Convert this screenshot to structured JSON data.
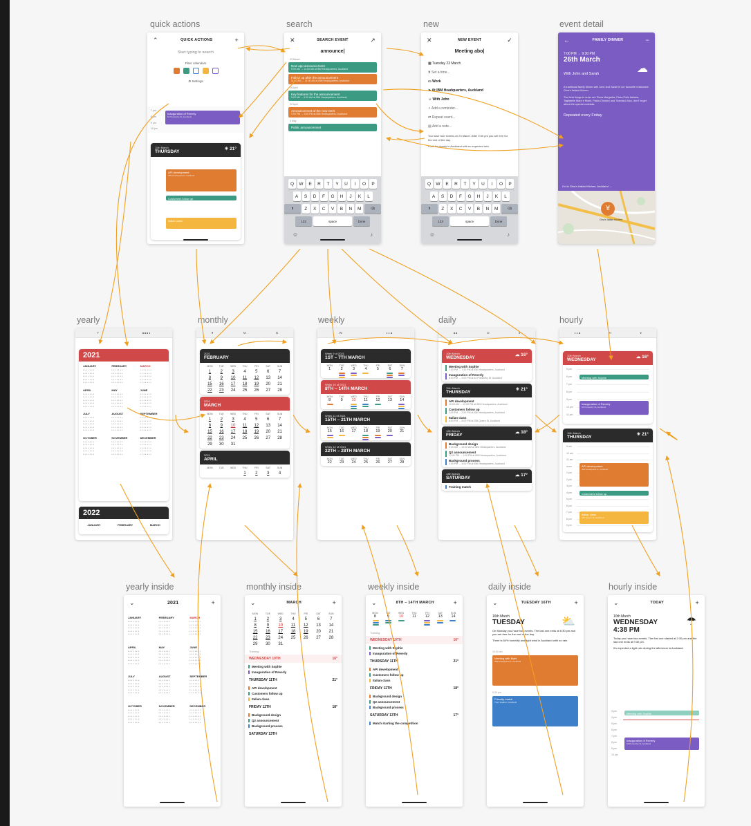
{
  "labels": {
    "quick_actions": "quick actions",
    "search": "search",
    "new": "new",
    "event_detail": "event detail",
    "yearly": "yearly",
    "monthly": "monthly",
    "weekly": "weekly",
    "daily": "daily",
    "hourly": "hourly",
    "yearly_inside": "yearly inside",
    "monthly_inside": "monthly inside",
    "weekly_inside": "weekly inside",
    "daily_inside": "daily inside",
    "hourly_inside": "hourly inside"
  },
  "colors": {
    "red": "#d04848",
    "dark": "#2b2b2b",
    "teal": "#3a9a82",
    "orange": "#e07b32",
    "purple": "#7a5cc2",
    "yellow": "#f4b63e",
    "blue": "#3d7fc9",
    "arrow": "#f0a020"
  },
  "quick": {
    "title": "QUICK ACTIONS",
    "search_hint": "Start typing to search",
    "filter": "Filter calendars",
    "settings": "Settings",
    "ev1": "Inauguration of Reverly",
    "ev1d": "64 Ponsonby St, Auckland",
    "date": "11th March",
    "day": "THURSDAY",
    "temp": "21°",
    "blk1": "API development",
    "blk1d": "IBM Headquarters, Auckland",
    "blk2": "Customers follow up",
    "blk3": "Italian class",
    "blk3d": "256 Queen St, Auckland",
    "times": [
      "7 pm",
      "8 pm",
      "9 pm",
      "10 pm"
    ],
    "times2": [
      "8 am",
      "9 am",
      "10 am",
      "11 am",
      "noon",
      "1 pm",
      "2 pm",
      "3 pm",
      "4 pm",
      "5 pm",
      "6 pm",
      "7 pm",
      "8 pm",
      "9 pm"
    ]
  },
  "search": {
    "title": "SEARCH EVENT",
    "query": "announce|",
    "d1": "23 March",
    "r1": "New app announcement",
    "r1d": "8:00 AM → 11:00 AM at IBM Headquarters, Auckland",
    "r2": "Follow up after the announcement",
    "r2d": "11:00 AM → 11:30 AM at IBM Headquarters, Auckland",
    "d2": "16 April",
    "r3": "Key features for the announcement",
    "r3d": "8:00 AM → 9:00 AM at IBM Headquarters, Auckland",
    "d3": "22 April",
    "r4": "Announcement of the new CEO",
    "r4d": "1:00 PM → 2:00 PM at IBM Headquarters, Auckland",
    "d4": "4 May",
    "r5": "Public announcement"
  },
  "kb": {
    "row1": [
      "Q",
      "W",
      "E",
      "R",
      "T",
      "Y",
      "U",
      "I",
      "O",
      "P"
    ],
    "row2": [
      "A",
      "S",
      "D",
      "F",
      "G",
      "H",
      "J",
      "K",
      "L"
    ],
    "row3": [
      "Z",
      "X",
      "C",
      "V",
      "B",
      "N",
      "M"
    ],
    "num": "123",
    "space": "space",
    "done": "Done"
  },
  "newev": {
    "title": "NEW EVENT",
    "query": "Meeting abo|",
    "date": "Tuesday 23 March",
    "time": "Set a time...",
    "cal": "Work",
    "place": "At IBM Headquarters, Auckland",
    "with": "With John",
    "rem": "Add a reminder...",
    "rep": "Repeat event...",
    "note": "Add a note...",
    "info": "You have four events on 23 March. After 9:30 pm you are free for the rest of the day.",
    "info2": "It will be cloudy in Auckland with no expected rain."
  },
  "detail": {
    "title": "FAMILY DINNER",
    "time": "7:00 PM → 9:30 PM",
    "date": "26th March",
    "with": "With John and Sarah",
    "desc": "A traditional family dinner with John and Sarah in our favourite restaurant: Gina's Italian Kitchen.",
    "desc2": "The best things to order are Pizza Margarita, Pizza Pollo Italiana, Tagliatelle Mare e Monti, Pasta Chicken and Tiramisu! Also, don't forget about the special cocktails.",
    "repeat": "Repeated every Friday",
    "goto": "Go to Gina's Italian Kitchen, Auckland →",
    "map_label": "Gina's Italian Kitchen"
  },
  "tabs": {
    "y": "Y",
    "m": "M",
    "w": "W",
    "d": "D",
    "h": "H"
  },
  "yearly": {
    "y1": "2021",
    "y2": "2022",
    "months": [
      "JANUARY",
      "FEBRUARY",
      "MARCH",
      "APRIL",
      "MAY",
      "JUNE",
      "JULY",
      "AUGUST",
      "SEPTEMBER",
      "OCTOBER",
      "NOVEMBER",
      "DECEMBER"
    ],
    "m2": [
      "JANUARY",
      "FEBRUARY",
      "MARCH"
    ]
  },
  "monthly": {
    "c1y": "2021",
    "c1m": "FEBRUARY",
    "c2y": "2021",
    "c2m": "MARCH",
    "c3y": "2021",
    "c3m": "APRIL",
    "days": [
      "MON",
      "TUE",
      "WED",
      "THU",
      "FRI",
      "SAT",
      "SUN"
    ],
    "feb": [
      "1",
      "2",
      "3",
      "4",
      "5",
      "6",
      "7",
      "8",
      "9",
      "10",
      "11",
      "12",
      "13",
      "14",
      "15",
      "16",
      "17",
      "18",
      "19",
      "20",
      "21",
      "22",
      "23",
      "24",
      "25",
      "26",
      "27",
      "28"
    ],
    "mar": [
      "1",
      "2",
      "3",
      "4",
      "5",
      "6",
      "7",
      "8",
      "9",
      "10",
      "11",
      "12",
      "13",
      "14",
      "15",
      "16",
      "17",
      "18",
      "19",
      "20",
      "21",
      "22",
      "23",
      "24",
      "25",
      "26",
      "27",
      "28",
      "29",
      "30",
      "31"
    ],
    "apr": [
      "1",
      "2",
      "3",
      "4"
    ]
  },
  "weekly": {
    "w1s": "Week 9 of 2021",
    "w1": "1ST – 7TH MARCH",
    "w2s": "Week 10 of 2021",
    "w2": "8TH – 14TH MARCH",
    "w3s": "Week 11 of 2021",
    "w3": "15TH – 21TH MARCH",
    "w4s": "Week 12 of 2021",
    "w4": "22TH – 28TH MARCH",
    "d1": [
      "1",
      "2",
      "3",
      "4",
      "5",
      "6",
      "7"
    ],
    "d2": [
      "8",
      "9",
      "10",
      "11",
      "12",
      "13",
      "14"
    ],
    "d3": [
      "15",
      "16",
      "17",
      "18",
      "19",
      "20",
      "21"
    ],
    "d4": [
      "22",
      "23",
      "24",
      "25",
      "26",
      "27",
      "28"
    ]
  },
  "daily": {
    "c1s": "10th March",
    "c1": "WEDNESDAY",
    "c1t": "16°",
    "e1": "Meeting with Sophie",
    "e1d": "7:00 PM → 7:30 PM at IBM Headquarters, Auckland",
    "e2": "Inauguration of Reverly",
    "e2d": "8:00 PM → 9:00 PM at 64 Ponsonby St, Auckland",
    "c2s": "11th March",
    "c2": "THURSDAY",
    "c2t": "21°",
    "e3": "API development",
    "e3d": "10:00 AM → 12:00 PM at IBM Headquarters, Auckland",
    "e4": "Customers follow up",
    "e4d": "2:00 PM → 2:30 PM at IBM Headquarters, Auckland",
    "e5": "Italian class",
    "e5d": "6:00 PM → 8:00 PM at 256 Queen St, Auckland",
    "c3s": "12th March",
    "c3": "FRIDAY",
    "c3t": "18°",
    "e6": "Background design",
    "e6d": "9:00 AM → 10:00 AM at IBM Headquarters, Auckland",
    "e7": "Q2 announcement",
    "e7d": "12:00 PM → 1:00 PM at IBM Headquarters, Auckland",
    "e8": "Background process",
    "e8d": "2:00 PM → 4:00 PM at IBM Headquarters, Auckland",
    "c4s": "13th March",
    "c4": "SATURDAY",
    "c4t": "17°",
    "e9": "Training match"
  },
  "hourly": {
    "c1s": "10th March",
    "c1": "WEDNESDAY",
    "c1t": "16°",
    "e1": "Meeting with Sophie",
    "e2": "Inauguration of Reverly",
    "e2d": "64 Ponsonby St, Auckland",
    "c2s": "11th March",
    "c2": "THURSDAY",
    "c2t": "21°",
    "e3": "API development",
    "e3d": "IBM Headquarters, Auckland",
    "e4": "Customers follow up",
    "e5": "Italian class",
    "e5d": "256 Queen St, Auckland",
    "times1": [
      "5 pm",
      "6 pm",
      "7 pm",
      "8 pm",
      "9 pm",
      "10 pm",
      "11 pm"
    ],
    "times2": [
      "9 am",
      "10 am",
      "11 am",
      "noon",
      "1 pm",
      "2 pm",
      "3 pm",
      "4 pm",
      "5 pm",
      "6 pm",
      "7 pm",
      "8 pm",
      "9 pm"
    ]
  },
  "yin": {
    "title": "2021"
  },
  "min": {
    "title": "MARCH",
    "s1": "WEDNESDAY 10TH",
    "s1t": "16°",
    "e1": "Meeting with Sophie",
    "e2": "Inauguration of Reverly",
    "s2": "THURSDAY 11TH",
    "s2t": "21°",
    "e3": "API development",
    "e4": "Customers follow up",
    "e5": "Italian class",
    "s3": "FRIDAY 12TH",
    "s3t": "18°",
    "e6": "Background design",
    "e7": "Q2 announcement",
    "e8": "Background process",
    "s4": "SATURDAY 13TH",
    "tr": "Training"
  },
  "win": {
    "title": "8TH – 14TH MARCH",
    "tr": "Training",
    "s1": "WEDNESDAY 10TH",
    "s1t": "16°",
    "e1": "Meeting with Sophie",
    "e2": "Inauguration of Reverly",
    "s2": "THURSDAY 11TH",
    "s2t": "21°",
    "e3": "API development",
    "e4": "Customers follow up",
    "e5": "Italian class",
    "s3": "FRIDAY 12TH",
    "s3t": "18°",
    "e6": "Background design",
    "e7": "Q2 announcement",
    "e8": "Background process",
    "s4": "SATURDAY 13TH",
    "s4t": "17°",
    "e9": "Match starting the competition"
  },
  "din": {
    "title": "TUESDAY 16TH",
    "s": "16th March",
    "day": "TUESDAY",
    "info": "On Monday you have two events. The last one ends at 6:30 pm and you are free for the rest of the day.",
    "info2": "There is 84% humidity and light wind in Auckland with no rain.",
    "t1": "10:00 am",
    "b1": "Meeting with Mark",
    "b1d": "IBM Headquarters, Auckland",
    "t2": "5:30 pm",
    "b2": "Friendly match",
    "b2d": "Tyler Stadium, Auckland"
  },
  "hin": {
    "title": "TODAY",
    "s": "10th March",
    "day": "WEDNESDAY",
    "time": "4:38 PM",
    "info": "Today you have two events. The first one started at 2:30 pm and the last one ends at 9:30 pm.",
    "info2": "It's expected a light rain during the afternoon in Auckland.",
    "e1": "Meeting with Sophie",
    "e2": "Inauguration of Reverly",
    "e2d": "64 Ponsonby St, Auckland",
    "times": [
      "3 pm",
      "4 pm",
      "5 pm",
      "6 pm",
      "7 pm",
      "8 pm",
      "9 pm",
      "10 pm"
    ]
  }
}
